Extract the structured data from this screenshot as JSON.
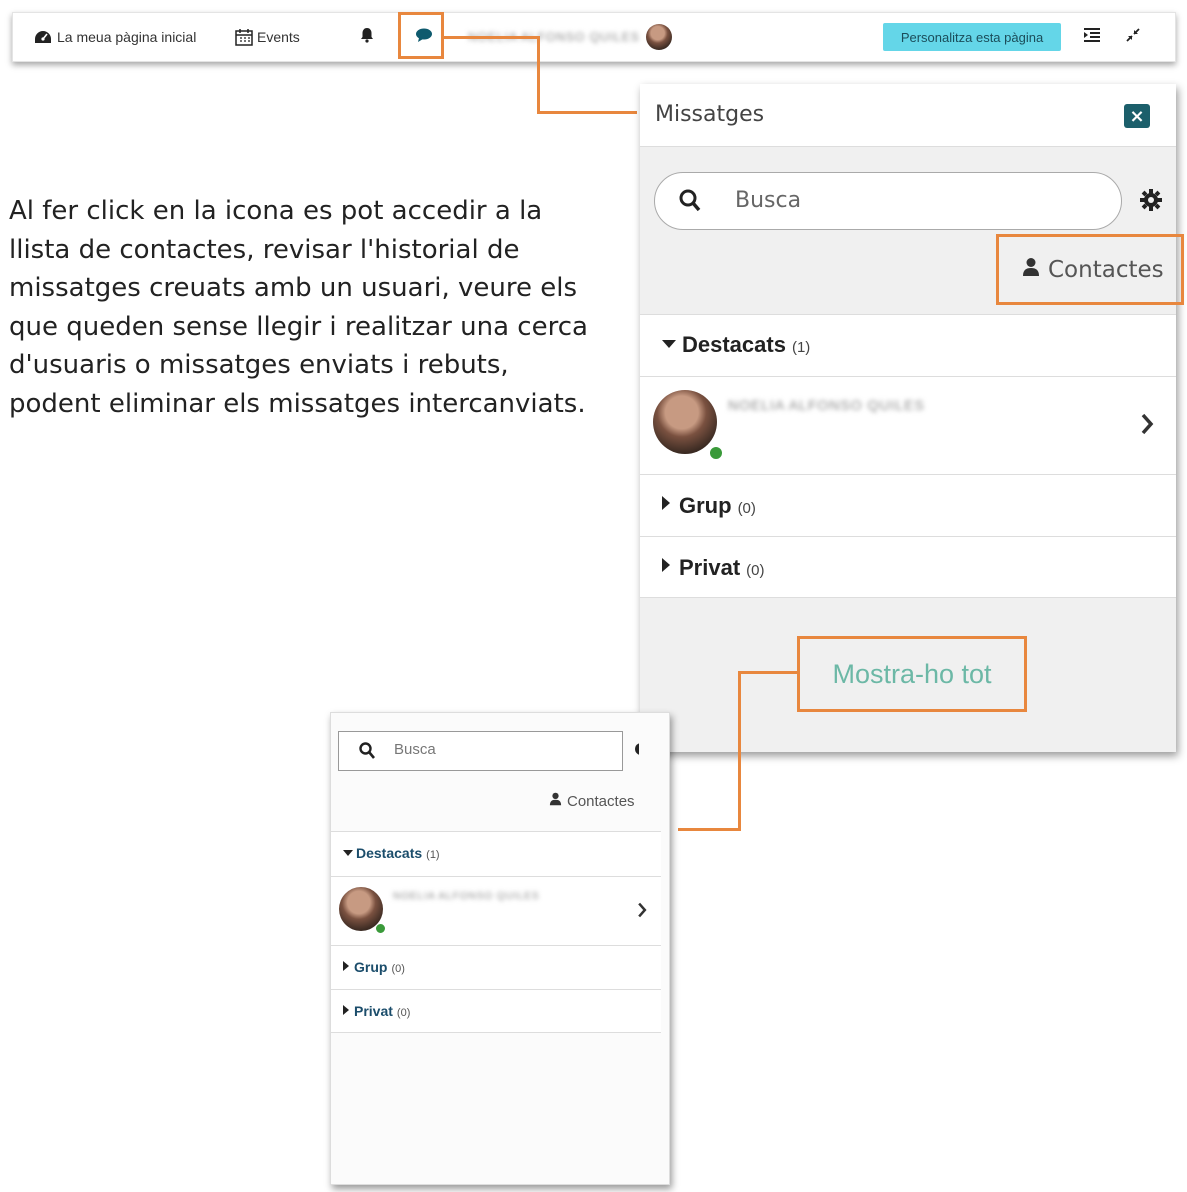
{
  "navbar": {
    "home_label": "La meua pàgina inicial",
    "events_label": "Events",
    "user_name_blurred": "NOELIA ALFONSO QUILES",
    "customize_label": "Personalitza esta pàgina"
  },
  "description": "Al fer click en la icona es pot accedir a la llista de contactes, revisar l'historial de missatges creuats amb un usuari, veure els que queden sense llegir i realitzar una cerca d'usuaris o missatges enviats i rebuts, podent eliminar els missatges intercanviats.",
  "panel": {
    "title": "Missatges",
    "close_icon": "close-icon",
    "search_placeholder": "Busca",
    "contacts_label": "Contactes",
    "sections": [
      {
        "label": "Destacats",
        "count": "(1)",
        "expanded": true
      },
      {
        "label": "Grup",
        "count": "(0)",
        "expanded": false
      },
      {
        "label": "Privat",
        "count": "(0)",
        "expanded": false
      }
    ],
    "contact_name_blurred": "NOELIA ALFONSO QUILES",
    "show_all_label": "Mostra-ho tot"
  },
  "small_panel": {
    "search_placeholder": "Busca",
    "contacts_label": "Contactes",
    "sections": [
      {
        "label": "Destacats",
        "count": "(1)"
      },
      {
        "label": "Grup",
        "count": "(0)"
      },
      {
        "label": "Privat",
        "count": "(0)"
      }
    ],
    "contact_name_blurred": "NOELIA ALFONSO QUILES"
  },
  "colors": {
    "highlight": "#e8873e",
    "customize_button": "#64d6e8",
    "close_button": "#1c5f6b",
    "online_dot": "#3a9a3a",
    "show_all_text": "#6cb8a6"
  }
}
